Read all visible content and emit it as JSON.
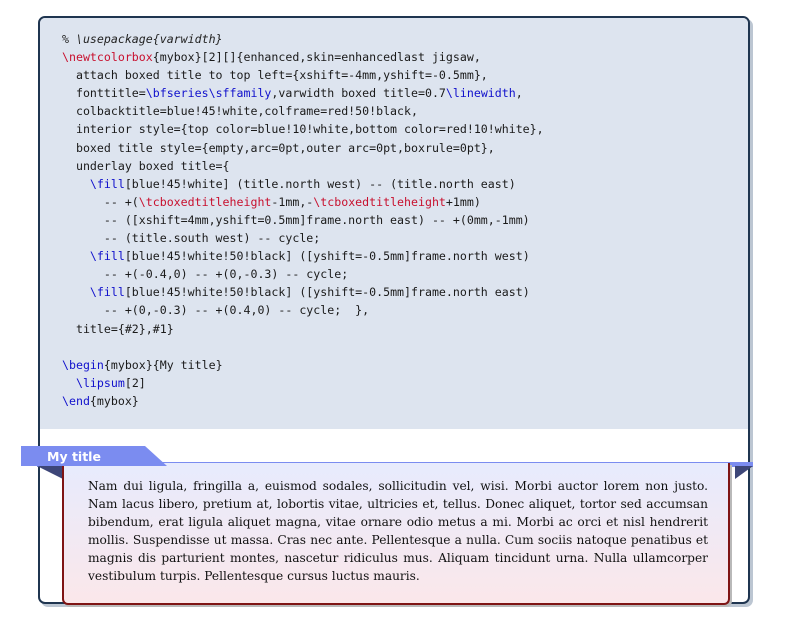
{
  "code_lines": [
    [
      {
        "t": "% \\usepackage{varwidth}",
        "c": "cm"
      }
    ],
    [
      {
        "t": "\\newtcolorbox",
        "c": "kw-red"
      },
      {
        "t": "{mybox}[2][]{enhanced,skin=enhancedlast jigsaw,",
        "c": ""
      }
    ],
    [
      {
        "t": "  attach boxed title to top left={xshift=-4mm,yshift=-0.5mm},",
        "c": ""
      }
    ],
    [
      {
        "t": "  fonttitle=",
        "c": ""
      },
      {
        "t": "\\bfseries\\sffamily",
        "c": "kw-blue"
      },
      {
        "t": ",varwidth boxed title=0.7",
        "c": ""
      },
      {
        "t": "\\linewidth",
        "c": "kw-blue"
      },
      {
        "t": ",",
        "c": ""
      }
    ],
    [
      {
        "t": "  colbacktitle=blue!45!white,colframe=red!50!black,",
        "c": ""
      }
    ],
    [
      {
        "t": "  interior style={top color=blue!10!white,bottom color=red!10!white},",
        "c": ""
      }
    ],
    [
      {
        "t": "  boxed title style={empty,arc=0pt,outer arc=0pt,boxrule=0pt},",
        "c": ""
      }
    ],
    [
      {
        "t": "  underlay boxed title={",
        "c": ""
      }
    ],
    [
      {
        "t": "    ",
        "c": ""
      },
      {
        "t": "\\fill",
        "c": "kw-blue"
      },
      {
        "t": "[blue!45!white] (title.north west) -- (title.north east)",
        "c": ""
      }
    ],
    [
      {
        "t": "      -- +(",
        "c": ""
      },
      {
        "t": "\\tcboxedtitleheight",
        "c": "kw-red"
      },
      {
        "t": "-1mm,-",
        "c": ""
      },
      {
        "t": "\\tcboxedtitleheight",
        "c": "kw-red"
      },
      {
        "t": "+1mm)",
        "c": ""
      }
    ],
    [
      {
        "t": "      -- ([xshift=4mm,yshift=0.5mm]frame.north east) -- +(0mm,-1mm)",
        "c": ""
      }
    ],
    [
      {
        "t": "      -- (title.south west) -- cycle;",
        "c": ""
      }
    ],
    [
      {
        "t": "    ",
        "c": ""
      },
      {
        "t": "\\fill",
        "c": "kw-blue"
      },
      {
        "t": "[blue!45!white!50!black] ([yshift=-0.5mm]frame.north west)",
        "c": ""
      }
    ],
    [
      {
        "t": "      -- +(-0.4,0) -- +(0,-0.3) -- cycle;",
        "c": ""
      }
    ],
    [
      {
        "t": "    ",
        "c": ""
      },
      {
        "t": "\\fill",
        "c": "kw-blue"
      },
      {
        "t": "[blue!45!white!50!black] ([yshift=-0.5mm]frame.north east)",
        "c": ""
      }
    ],
    [
      {
        "t": "      -- +(0,-0.3) -- +(0.4,0) -- cycle;  },",
        "c": ""
      }
    ],
    [
      {
        "t": "  title={#2},#1}",
        "c": ""
      }
    ],
    [
      {
        "t": "",
        "c": ""
      }
    ],
    [
      {
        "t": "\\begin",
        "c": "kw-blue"
      },
      {
        "t": "{mybox}{My title}",
        "c": ""
      }
    ],
    [
      {
        "t": "  ",
        "c": ""
      },
      {
        "t": "\\lipsum",
        "c": "kw-blue"
      },
      {
        "t": "[2]",
        "c": ""
      }
    ],
    [
      {
        "t": "\\end",
        "c": "kw-blue"
      },
      {
        "t": "{mybox}",
        "c": ""
      }
    ]
  ],
  "result": {
    "title": "My title",
    "paragraph": "Nam dui ligula, fringilla a, euismod sodales, sollicitudin vel, wisi. Morbi auctor lorem non justo. Nam lacus libero, pretium at, lobortis vitae, ultricies et, tellus. Donec aliquet, tortor sed accumsan bibendum, erat ligula aliquet magna, vitae ornare odio metus a mi. Morbi ac orci et nisl hendrerit mollis. Suspendisse ut massa. Cras nec ante. Pellentesque a nulla. Cum sociis natoque penatibus et magnis dis parturient montes, nascetur ridiculus mus. Aliquam tincidunt urna. Nulla ullamcorper vestibulum turpis. Pellentesque cursus luctus mauris."
  },
  "colors": {
    "frame": "#1f3550",
    "code_bg": "#dde4ef",
    "title_bg": "#7b8cf0",
    "title_flap": "#3d4678",
    "inner_frame": "#7f1414",
    "keyword_red": "#c8102e",
    "keyword_blue": "#1111cc"
  }
}
